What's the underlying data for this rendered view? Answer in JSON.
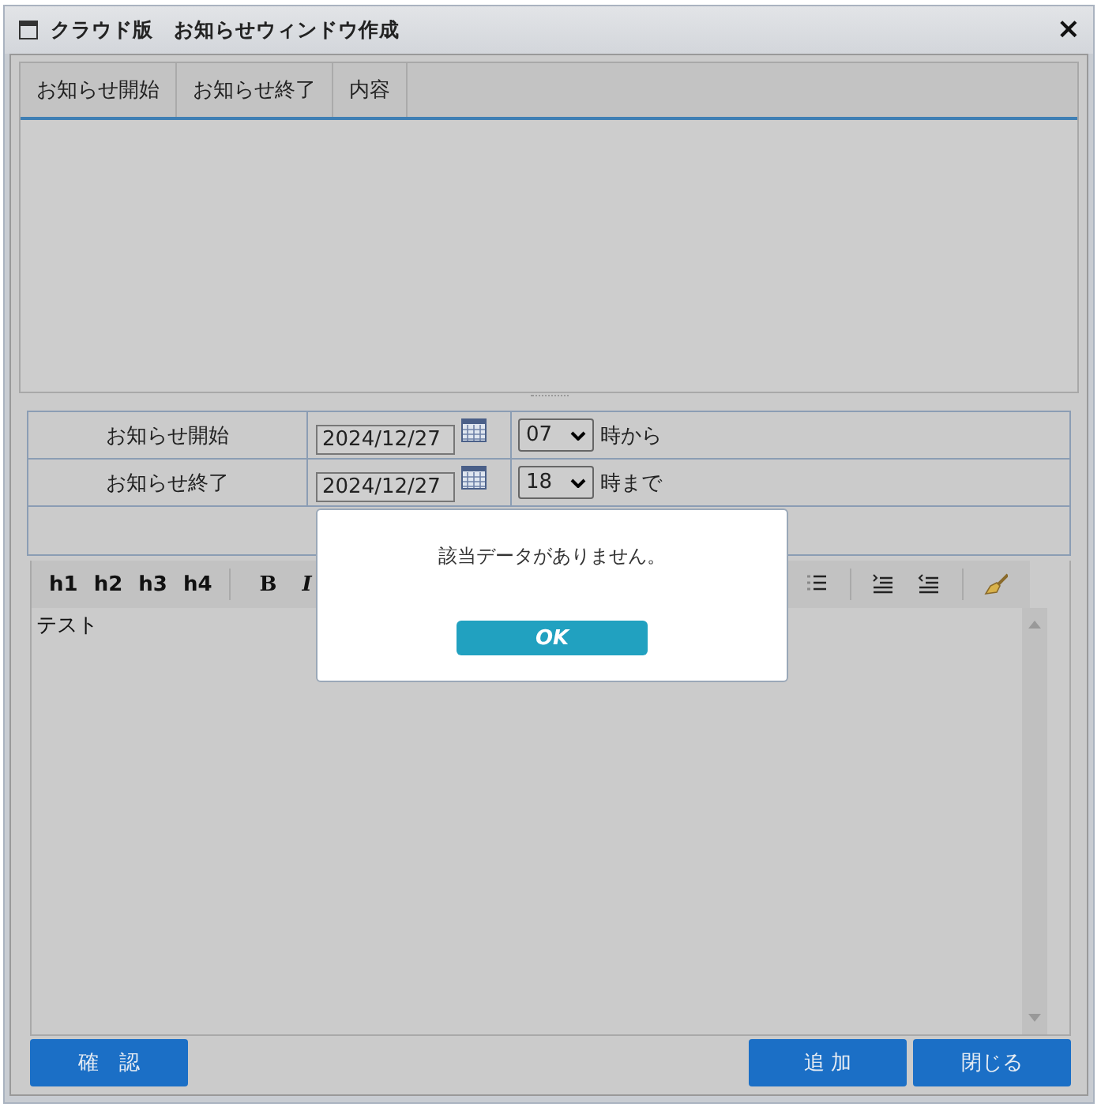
{
  "window": {
    "title": "クラウド版　お知らせウィンドウ作成",
    "close": "×"
  },
  "grid": {
    "columns": [
      "お知らせ開始",
      "お知らせ終了",
      "内容"
    ]
  },
  "form": {
    "rows": [
      {
        "label": "お知らせ開始",
        "date": "2024/12/27",
        "hour": "07",
        "suffix": "時から"
      },
      {
        "label": "お知らせ終了",
        "date": "2024/12/27",
        "hour": "18",
        "suffix": "時まで"
      }
    ]
  },
  "editor": {
    "toolbar": [
      {
        "kind": "text",
        "label": "h1"
      },
      {
        "kind": "text",
        "label": "h2"
      },
      {
        "kind": "text",
        "label": "h3"
      },
      {
        "kind": "text",
        "label": "h4"
      },
      {
        "kind": "sep"
      },
      {
        "kind": "bold",
        "label": "B"
      },
      {
        "kind": "italic",
        "label": "I"
      },
      {
        "kind": "gap"
      },
      {
        "kind": "list"
      },
      {
        "kind": "sep"
      },
      {
        "kind": "indent"
      },
      {
        "kind": "outdent"
      },
      {
        "kind": "sep"
      },
      {
        "kind": "brush"
      }
    ],
    "content": "テスト"
  },
  "buttons": {
    "left": [
      "確　認"
    ],
    "right": [
      "追 加",
      "閉じる"
    ]
  },
  "dialog": {
    "message": "該当データがありません。",
    "button": "OK"
  }
}
